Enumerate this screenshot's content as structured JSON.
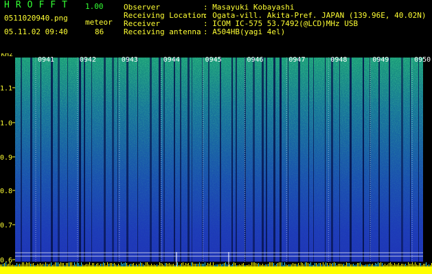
{
  "header": {
    "app_name": "HROFFT",
    "version": "1.00",
    "file_name": "0511020940.png",
    "datetime": "05.11.02 09:40",
    "meteor_label": "meteor",
    "meteor_count": "86"
  },
  "info": [
    {
      "key": "Observer",
      "value": ": Masayuki Kobayashi"
    },
    {
      "key": "Receiving Location",
      "value": ": Ogata-vill. Akita-Pref. JAPAN (139.96E, 40.02N)"
    },
    {
      "key": "Receiver",
      "value": ": ICOM IC-575 53.7492(@LCD)MHz USB"
    },
    {
      "key": "Receiving antenna",
      "value": ": A504HB(yagi 4el)"
    }
  ],
  "spectrogram": {
    "y_unit": "kHz",
    "y_ticks": [
      "1.1",
      "1.0",
      "0.9",
      "0.8",
      "0.7",
      "0.6"
    ],
    "time_labels": [
      "0941",
      "0942",
      "0943",
      "0944",
      "0945",
      "0946",
      "0947",
      "0948",
      "0949",
      "0950"
    ],
    "colors": {
      "text": "#ffff33",
      "title": "#33ff33",
      "grid": "#ffffff",
      "baseline": "#ffff00"
    }
  }
}
